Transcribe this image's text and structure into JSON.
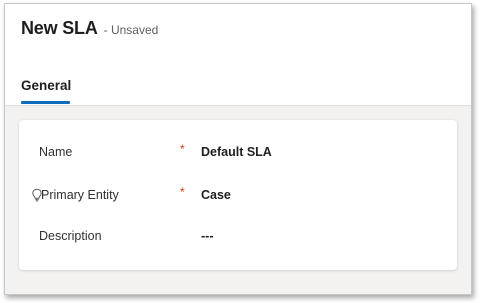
{
  "form": {
    "title": "New SLA",
    "status": "- Unsaved"
  },
  "tabs": [
    {
      "label": "General",
      "selected": true
    }
  ],
  "fields": [
    {
      "label": "Name",
      "required_marker": "*",
      "value": "Default SLA"
    },
    {
      "label": "Primary Entity",
      "required_marker": "*",
      "value": "Case",
      "icon": "lightbulb-icon"
    },
    {
      "label": "Description",
      "value": "---"
    }
  ],
  "colors": {
    "accent": "#0f6cbd",
    "required": "#d83b01",
    "background": "#f3f2f1"
  }
}
